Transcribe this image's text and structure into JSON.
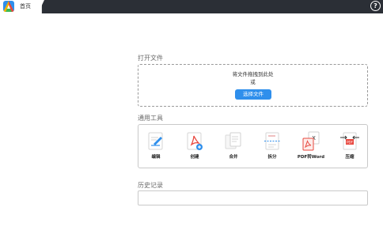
{
  "titlebar": {
    "tab_label": "首页",
    "logo_icon": "app-logo-icon",
    "help_icon": "help-icon",
    "help_glyph": "?"
  },
  "open_file": {
    "heading": "打开文件",
    "drop_hint": "将文件拖拽到此处",
    "or_text": "或",
    "choose_label": "选择文件"
  },
  "tools": {
    "heading": "通用工具",
    "items": [
      {
        "label": "编辑",
        "icon": "edit-pdf-icon"
      },
      {
        "label": "创建",
        "icon": "create-pdf-icon"
      },
      {
        "label": "合并",
        "icon": "merge-pdf-icon"
      },
      {
        "label": "拆分",
        "icon": "split-pdf-icon"
      },
      {
        "label": "PDF转Word",
        "icon": "pdf-to-word-icon"
      },
      {
        "label": "压缩",
        "icon": "compress-pdf-icon"
      }
    ]
  },
  "history": {
    "heading": "历史记录"
  },
  "colors": {
    "titlebar_bg": "#2b2f36",
    "accent": "#2f8fec",
    "pdf_red": "#e8473e"
  }
}
